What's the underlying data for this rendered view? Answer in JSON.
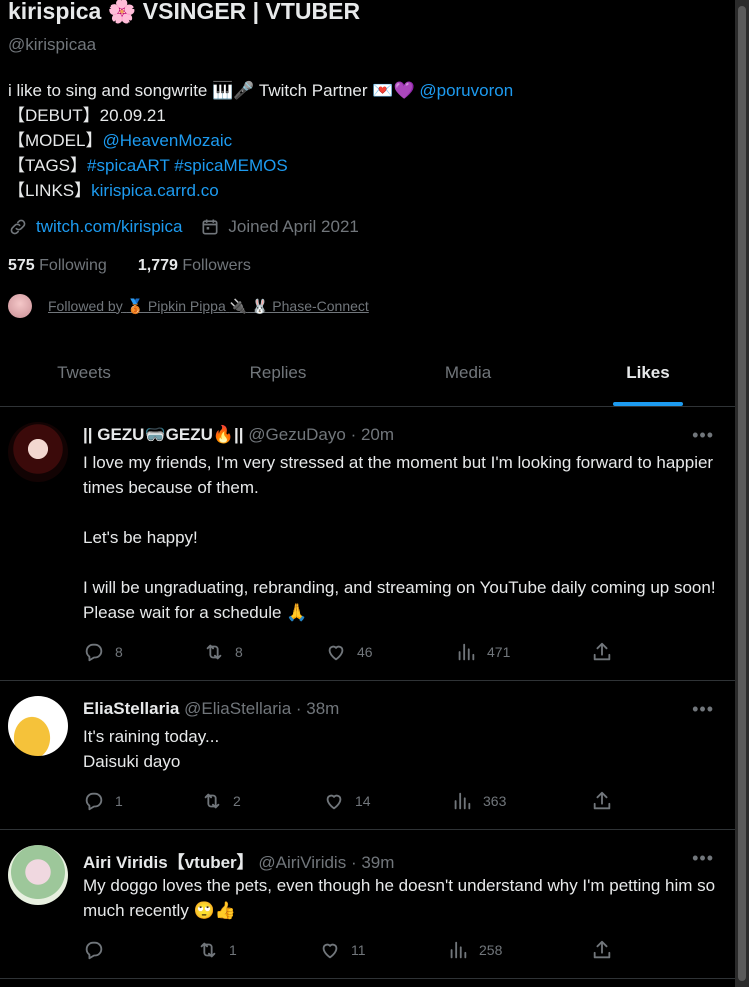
{
  "profile": {
    "name": "kirispica",
    "name_emoji": "🌸",
    "name_suffix": "VSINGER | VTUBER",
    "handle": "@kirispicaa",
    "bio": {
      "line1_text": "i like to sing and songwrite",
      "line1_emoji": "🎹🎤",
      "line1_partner": "Twitch Partner",
      "line1_emoji2": "💌💜",
      "line1_link": "@poruvoron",
      "debut_label": "【DEBUT】",
      "debut_value": "20.09.21",
      "model_label": "【MODEL】",
      "model_link": "@HeavenMozaic",
      "tags_label": "【TAGS】",
      "tag1": "#spicaART",
      "tag2": "#spicaMEMOS",
      "links_label": "【LINKS】",
      "links_link": "kirispica.carrd.co"
    },
    "website": "twitch.com/kirispica",
    "joined": "Joined April 2021",
    "following_count": "575",
    "following_label": "Following",
    "followers_count": "1,779",
    "followers_label": "Followers",
    "followed_by_prefix": "Followed by",
    "followed_by_1": "🥉 Pipkin Pippa",
    "followed_by_1_emoji": "🔌",
    "followed_by_2": "🐰 Phase-Connect"
  },
  "tabs": [
    {
      "label": "Tweets"
    },
    {
      "label": "Replies"
    },
    {
      "label": "Media"
    },
    {
      "label": "Likes"
    }
  ],
  "active_tab": "Likes",
  "tweets": [
    {
      "name": "|| GEZU🥽GEZU🔥||",
      "handle": "@GezuDayo",
      "time": "· 20m",
      "body": "I love my friends, I'm very stressed at the moment but I'm looking forward to happier times because of them.\n\nLet's be happy!\n\nI will be ungraduating, rebranding, and streaming on YouTube daily coming up soon! Please wait for a schedule 🙏",
      "replies": "8",
      "retweets": "8",
      "likes": "46",
      "views": "471"
    },
    {
      "name": "EliaStellaria",
      "handle": "@EliaStellaria",
      "time": "· 38m",
      "body": "It's raining today...\nDaisuki dayo",
      "replies": "1",
      "retweets": "2",
      "likes": "14",
      "views": "363"
    },
    {
      "name": "Airi Viridis【vtuber】",
      "handle": "@AiriViridis",
      "time": "· 39m",
      "body": "My doggo loves the pets, even though he doesn't understand why I'm petting him so much recently 🙄👍",
      "replies": "",
      "retweets": "1",
      "likes": "11",
      "views": "258"
    }
  ],
  "more_label": "•••",
  "colors": {
    "accent": "#1d9bf0",
    "muted": "#71767b",
    "text": "#e7e9ea",
    "bg": "#000000",
    "border": "#2f3336"
  }
}
